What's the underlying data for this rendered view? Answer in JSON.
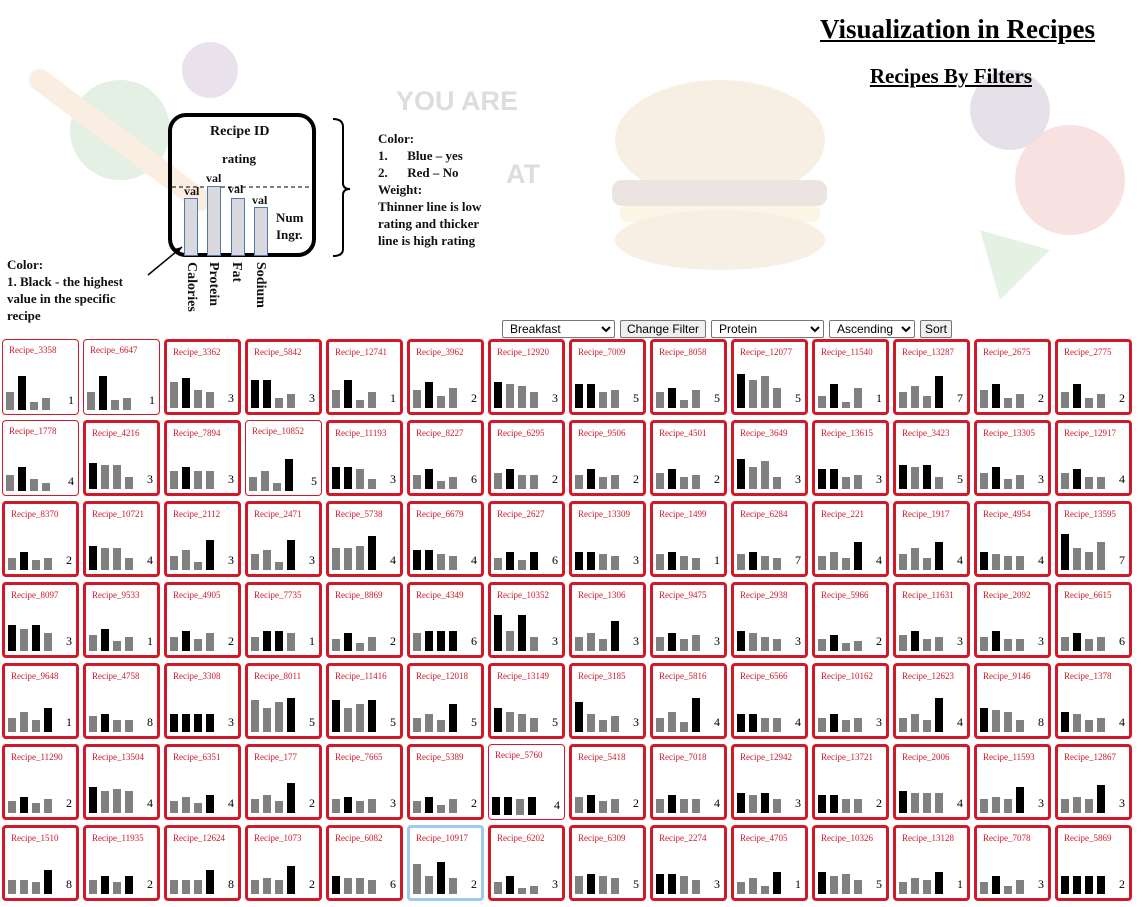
{
  "header": {
    "title": "Visualization in Recipes",
    "subtitle": "Recipes By Filters"
  },
  "background_text": {
    "line1": "YOU ARE",
    "line2": "AT"
  },
  "legend": {
    "card_title": "Recipe ID",
    "card_rating": "rating",
    "bar_value_label": "val",
    "num_ingr_line1": "Num",
    "num_ingr_line2": "Ingr.",
    "axis_labels": [
      "Calories",
      "Protein",
      "Fat",
      "Sodium"
    ],
    "color_title": "Color:",
    "color_items": [
      "1.      Blue – yes",
      "2.      Red – No"
    ],
    "weight_title": "Weight:",
    "weight_lines": [
      "Thinner line is low",
      "rating and thicker",
      "line is high rating"
    ],
    "black_title": "Color:",
    "black_lines": [
      "1. Black - the highest",
      "value in the specific",
      "recipe"
    ]
  },
  "controls": {
    "meal_selected": "Breakfast",
    "change_filter_label": "Change Filter",
    "sort_field_selected": "Protein",
    "sort_order_selected": "Ascending",
    "sort_label": "Sort"
  },
  "colors": {
    "red_border": "#d01a2a",
    "blue_border": "#9fc9ef",
    "bar_gray": "#808080",
    "bar_black": "#000000"
  },
  "recipes": [
    {
      "id": "Recipe_3358",
      "v": [
        0.45,
        0.85,
        0.2,
        0.3
      ],
      "n": 1,
      "b": "red",
      "w": 1
    },
    {
      "id": "Recipe_6647",
      "v": [
        0.45,
        0.85,
        0.25,
        0.3
      ],
      "n": 1,
      "b": "red",
      "w": 1
    },
    {
      "id": "Recipe_3362",
      "v": [
        0.65,
        0.75,
        0.45,
        0.4
      ],
      "n": 3,
      "b": "red",
      "w": 3
    },
    {
      "id": "Recipe_5842",
      "v": [
        0.7,
        0.7,
        0.25,
        0.35
      ],
      "n": 3,
      "b": "red",
      "w": 3
    },
    {
      "id": "Recipe_12741",
      "v": [
        0.45,
        0.7,
        0.2,
        0.4
      ],
      "n": 1,
      "b": "red",
      "w": 3
    },
    {
      "id": "Recipe_3962",
      "v": [
        0.45,
        0.65,
        0.3,
        0.5
      ],
      "n": 2,
      "b": "red",
      "w": 3
    },
    {
      "id": "Recipe_12920",
      "v": [
        0.65,
        0.6,
        0.55,
        0.4
      ],
      "n": 3,
      "b": "red",
      "w": 3
    },
    {
      "id": "Recipe_7009",
      "v": [
        0.6,
        0.6,
        0.4,
        0.45
      ],
      "n": 5,
      "b": "red",
      "w": 3
    },
    {
      "id": "Recipe_8058",
      "v": [
        0.4,
        0.5,
        0.2,
        0.45
      ],
      "n": 5,
      "b": "red",
      "w": 3
    },
    {
      "id": "Recipe_12077",
      "v": [
        0.85,
        0.7,
        0.8,
        0.5
      ],
      "n": 5,
      "b": "red",
      "w": 3
    },
    {
      "id": "Recipe_11540",
      "v": [
        0.3,
        0.6,
        0.15,
        0.5
      ],
      "n": 1,
      "b": "red",
      "w": 3
    },
    {
      "id": "Recipe_13287",
      "v": [
        0.4,
        0.55,
        0.3,
        0.8
      ],
      "n": 7,
      "b": "red",
      "w": 3
    },
    {
      "id": "Recipe_2675",
      "v": [
        0.45,
        0.6,
        0.25,
        0.35
      ],
      "n": 2,
      "b": "red",
      "w": 3
    },
    {
      "id": "Recipe_2775",
      "v": [
        0.4,
        0.6,
        0.25,
        0.35
      ],
      "n": 2,
      "b": "red",
      "w": 3
    },
    {
      "id": "Recipe_1778",
      "v": [
        0.4,
        0.6,
        0.3,
        0.2
      ],
      "n": 4,
      "b": "red",
      "w": 1
    },
    {
      "id": "Recipe_4216",
      "v": [
        0.65,
        0.6,
        0.6,
        0.3
      ],
      "n": 3,
      "b": "red",
      "w": 3
    },
    {
      "id": "Recipe_7894",
      "v": [
        0.45,
        0.55,
        0.45,
        0.45
      ],
      "n": 3,
      "b": "red",
      "w": 3
    },
    {
      "id": "Recipe_10852",
      "v": [
        0.35,
        0.5,
        0.2,
        0.8
      ],
      "n": 5,
      "b": "red",
      "w": 1
    },
    {
      "id": "Recipe_11193",
      "v": [
        0.55,
        0.55,
        0.5,
        0.25
      ],
      "n": 3,
      "b": "red",
      "w": 3
    },
    {
      "id": "Recipe_8227",
      "v": [
        0.35,
        0.5,
        0.2,
        0.3
      ],
      "n": 6,
      "b": "red",
      "w": 3
    },
    {
      "id": "Recipe_6295",
      "v": [
        0.4,
        0.5,
        0.35,
        0.35
      ],
      "n": 2,
      "b": "red",
      "w": 3
    },
    {
      "id": "Recipe_9506",
      "v": [
        0.35,
        0.5,
        0.3,
        0.35
      ],
      "n": 2,
      "b": "red",
      "w": 3
    },
    {
      "id": "Recipe_4501",
      "v": [
        0.4,
        0.5,
        0.3,
        0.35
      ],
      "n": 2,
      "b": "red",
      "w": 3
    },
    {
      "id": "Recipe_3649",
      "v": [
        0.75,
        0.55,
        0.7,
        0.3
      ],
      "n": 3,
      "b": "red",
      "w": 3
    },
    {
      "id": "Recipe_13615",
      "v": [
        0.5,
        0.5,
        0.3,
        0.35
      ],
      "n": 3,
      "b": "red",
      "w": 3
    },
    {
      "id": "Recipe_3423",
      "v": [
        0.6,
        0.55,
        0.6,
        0.3
      ],
      "n": 5,
      "b": "red",
      "w": 3
    },
    {
      "id": "Recipe_13305",
      "v": [
        0.4,
        0.55,
        0.25,
        0.35
      ],
      "n": 3,
      "b": "red",
      "w": 3
    },
    {
      "id": "Recipe_12917",
      "v": [
        0.4,
        0.5,
        0.3,
        0.3
      ],
      "n": 4,
      "b": "red",
      "w": 3
    },
    {
      "id": "Recipe_8370",
      "v": [
        0.3,
        0.45,
        0.25,
        0.3
      ],
      "n": 2,
      "b": "red",
      "w": 3
    },
    {
      "id": "Recipe_10721",
      "v": [
        0.6,
        0.55,
        0.55,
        0.3
      ],
      "n": 4,
      "b": "red",
      "w": 3
    },
    {
      "id": "Recipe_2112",
      "v": [
        0.35,
        0.5,
        0.2,
        0.75
      ],
      "n": 3,
      "b": "red",
      "w": 3
    },
    {
      "id": "Recipe_2471",
      "v": [
        0.4,
        0.5,
        0.2,
        0.75
      ],
      "n": 3,
      "b": "red",
      "w": 3
    },
    {
      "id": "Recipe_5738",
      "v": [
        0.55,
        0.55,
        0.6,
        0.85
      ],
      "n": 4,
      "b": "red",
      "w": 3
    },
    {
      "id": "Recipe_6679",
      "v": [
        0.5,
        0.5,
        0.4,
        0.35
      ],
      "n": 4,
      "b": "red",
      "w": 3
    },
    {
      "id": "Recipe_2627",
      "v": [
        0.3,
        0.45,
        0.25,
        0.45
      ],
      "n": 6,
      "b": "red",
      "w": 3
    },
    {
      "id": "Recipe_13309",
      "v": [
        0.45,
        0.45,
        0.4,
        0.35
      ],
      "n": 3,
      "b": "red",
      "w": 3
    },
    {
      "id": "Recipe_1499",
      "v": [
        0.4,
        0.45,
        0.35,
        0.3
      ],
      "n": 1,
      "b": "red",
      "w": 3
    },
    {
      "id": "Recipe_6284",
      "v": [
        0.4,
        0.45,
        0.35,
        0.3
      ],
      "n": 7,
      "b": "red",
      "w": 3
    },
    {
      "id": "Recipe_221",
      "v": [
        0.35,
        0.45,
        0.3,
        0.7
      ],
      "n": 4,
      "b": "red",
      "w": 3
    },
    {
      "id": "Recipe_1917",
      "v": [
        0.4,
        0.55,
        0.3,
        0.7
      ],
      "n": 4,
      "b": "red",
      "w": 3
    },
    {
      "id": "Recipe_4954",
      "v": [
        0.45,
        0.4,
        0.35,
        0.35
      ],
      "n": 4,
      "b": "red",
      "w": 3
    },
    {
      "id": "Recipe_13595",
      "v": [
        0.9,
        0.55,
        0.45,
        0.7
      ],
      "n": 7,
      "b": "red",
      "w": 3
    },
    {
      "id": "Recipe_8097",
      "v": [
        0.65,
        0.55,
        0.65,
        0.45
      ],
      "n": 3,
      "b": "red",
      "w": 3
    },
    {
      "id": "Recipe_9533",
      "v": [
        0.4,
        0.55,
        0.25,
        0.35
      ],
      "n": 1,
      "b": "red",
      "w": 3
    },
    {
      "id": "Recipe_4905",
      "v": [
        0.35,
        0.5,
        0.3,
        0.45
      ],
      "n": 2,
      "b": "red",
      "w": 3
    },
    {
      "id": "Recipe_7735",
      "v": [
        0.35,
        0.5,
        0.5,
        0.45
      ],
      "n": 1,
      "b": "red",
      "w": 3
    },
    {
      "id": "Recipe_8869",
      "v": [
        0.3,
        0.45,
        0.2,
        0.35
      ],
      "n": 2,
      "b": "red",
      "w": 3
    },
    {
      "id": "Recipe_4349",
      "v": [
        0.45,
        0.5,
        0.5,
        0.5
      ],
      "n": 6,
      "b": "red",
      "w": 3
    },
    {
      "id": "Recipe_10352",
      "v": [
        0.9,
        0.5,
        0.9,
        0.35
      ],
      "n": 3,
      "b": "red",
      "w": 3
    },
    {
      "id": "Recipe_1306",
      "v": [
        0.35,
        0.45,
        0.3,
        0.75
      ],
      "n": 3,
      "b": "red",
      "w": 3
    },
    {
      "id": "Recipe_9475",
      "v": [
        0.35,
        0.45,
        0.3,
        0.4
      ],
      "n": 3,
      "b": "red",
      "w": 3
    },
    {
      "id": "Recipe_2938",
      "v": [
        0.5,
        0.45,
        0.35,
        0.3
      ],
      "n": 3,
      "b": "red",
      "w": 3
    },
    {
      "id": "Recipe_5966",
      "v": [
        0.3,
        0.4,
        0.2,
        0.25
      ],
      "n": 2,
      "b": "red",
      "w": 3
    },
    {
      "id": "Recipe_11631",
      "v": [
        0.4,
        0.5,
        0.3,
        0.35
      ],
      "n": 3,
      "b": "red",
      "w": 3
    },
    {
      "id": "Recipe_2092",
      "v": [
        0.35,
        0.5,
        0.3,
        0.3
      ],
      "n": 3,
      "b": "red",
      "w": 3
    },
    {
      "id": "Recipe_6615",
      "v": [
        0.35,
        0.45,
        0.3,
        0.35
      ],
      "n": 6,
      "b": "red",
      "w": 3
    },
    {
      "id": "Recipe_9648",
      "v": [
        0.35,
        0.5,
        0.3,
        0.6
      ],
      "n": 1,
      "b": "red",
      "w": 3
    },
    {
      "id": "Recipe_4758",
      "v": [
        0.4,
        0.45,
        0.3,
        0.3
      ],
      "n": 8,
      "b": "red",
      "w": 3
    },
    {
      "id": "Recipe_3308",
      "v": [
        0.45,
        0.45,
        0.45,
        0.45
      ],
      "n": 3,
      "b": "red",
      "w": 3
    },
    {
      "id": "Recipe_8011",
      "v": [
        0.8,
        0.6,
        0.75,
        0.85
      ],
      "n": 5,
      "b": "red",
      "w": 3
    },
    {
      "id": "Recipe_11416",
      "v": [
        0.8,
        0.6,
        0.7,
        0.8
      ],
      "n": 5,
      "b": "red",
      "w": 3
    },
    {
      "id": "Recipe_12018",
      "v": [
        0.35,
        0.45,
        0.3,
        0.7
      ],
      "n": 5,
      "b": "red",
      "w": 3
    },
    {
      "id": "Recipe_13149",
      "v": [
        0.6,
        0.5,
        0.45,
        0.35
      ],
      "n": 5,
      "b": "red",
      "w": 3
    },
    {
      "id": "Recipe_3185",
      "v": [
        0.75,
        0.45,
        0.3,
        0.4
      ],
      "n": 3,
      "b": "red",
      "w": 3
    },
    {
      "id": "Recipe_5816",
      "v": [
        0.35,
        0.5,
        0.25,
        0.85
      ],
      "n": 4,
      "b": "red",
      "w": 3
    },
    {
      "id": "Recipe_6566",
      "v": [
        0.45,
        0.45,
        0.35,
        0.35
      ],
      "n": 4,
      "b": "red",
      "w": 3
    },
    {
      "id": "Recipe_10162",
      "v": [
        0.35,
        0.45,
        0.3,
        0.35
      ],
      "n": 3,
      "b": "red",
      "w": 3
    },
    {
      "id": "Recipe_12623",
      "v": [
        0.35,
        0.45,
        0.3,
        0.85
      ],
      "n": 4,
      "b": "red",
      "w": 3
    },
    {
      "id": "Recipe_9146",
      "v": [
        0.6,
        0.55,
        0.5,
        0.3
      ],
      "n": 8,
      "b": "red",
      "w": 3
    },
    {
      "id": "Recipe_1378",
      "v": [
        0.5,
        0.45,
        0.3,
        0.35
      ],
      "n": 4,
      "b": "red",
      "w": 3
    },
    {
      "id": "Recipe_11290",
      "v": [
        0.3,
        0.4,
        0.25,
        0.35
      ],
      "n": 2,
      "b": "red",
      "w": 3
    },
    {
      "id": "Recipe_13504",
      "v": [
        0.65,
        0.55,
        0.6,
        0.55
      ],
      "n": 4,
      "b": "red",
      "w": 3
    },
    {
      "id": "Recipe_6351",
      "v": [
        0.3,
        0.4,
        0.25,
        0.45
      ],
      "n": 4,
      "b": "red",
      "w": 3
    },
    {
      "id": "Recipe_177",
      "v": [
        0.35,
        0.45,
        0.3,
        0.75
      ],
      "n": 2,
      "b": "red",
      "w": 3
    },
    {
      "id": "Recipe_7665",
      "v": [
        0.35,
        0.4,
        0.3,
        0.35
      ],
      "n": 3,
      "b": "red",
      "w": 3
    },
    {
      "id": "Recipe_5389",
      "v": [
        0.3,
        0.4,
        0.2,
        0.35
      ],
      "n": 2,
      "b": "red",
      "w": 3
    },
    {
      "id": "Recipe_5760",
      "v": [
        0.45,
        0.45,
        0.4,
        0.45
      ],
      "n": 4,
      "b": "red",
      "w": 1
    },
    {
      "id": "Recipe_5418",
      "v": [
        0.4,
        0.45,
        0.3,
        0.35
      ],
      "n": 2,
      "b": "red",
      "w": 3
    },
    {
      "id": "Recipe_7018",
      "v": [
        0.35,
        0.45,
        0.35,
        0.35
      ],
      "n": 4,
      "b": "red",
      "w": 3
    },
    {
      "id": "Recipe_12942",
      "v": [
        0.5,
        0.45,
        0.5,
        0.35
      ],
      "n": 3,
      "b": "red",
      "w": 3
    },
    {
      "id": "Recipe_13721",
      "v": [
        0.45,
        0.45,
        0.35,
        0.35
      ],
      "n": 2,
      "b": "red",
      "w": 3
    },
    {
      "id": "Recipe_2006",
      "v": [
        0.55,
        0.5,
        0.5,
        0.5
      ],
      "n": 4,
      "b": "red",
      "w": 3
    },
    {
      "id": "Recipe_11593",
      "v": [
        0.35,
        0.4,
        0.35,
        0.65
      ],
      "n": 3,
      "b": "red",
      "w": 3
    },
    {
      "id": "Recipe_12867",
      "v": [
        0.35,
        0.4,
        0.35,
        0.7
      ],
      "n": 3,
      "b": "red",
      "w": 3
    },
    {
      "id": "Recipe_1510",
      "v": [
        0.35,
        0.35,
        0.3,
        0.6
      ],
      "n": 8,
      "b": "red",
      "w": 3
    },
    {
      "id": "Recipe_11935",
      "v": [
        0.35,
        0.45,
        0.3,
        0.45
      ],
      "n": 2,
      "b": "red",
      "w": 3
    },
    {
      "id": "Recipe_12624",
      "v": [
        0.35,
        0.35,
        0.35,
        0.6
      ],
      "n": 8,
      "b": "red",
      "w": 3
    },
    {
      "id": "Recipe_1073",
      "v": [
        0.35,
        0.4,
        0.35,
        0.7
      ],
      "n": 2,
      "b": "red",
      "w": 3
    },
    {
      "id": "Recipe_6082",
      "v": [
        0.45,
        0.4,
        0.4,
        0.35
      ],
      "n": 6,
      "b": "red",
      "w": 3
    },
    {
      "id": "Recipe_10917",
      "v": [
        0.75,
        0.45,
        0.8,
        0.4
      ],
      "n": 2,
      "b": "blue",
      "w": 3
    },
    {
      "id": "Recipe_6202",
      "v": [
        0.3,
        0.45,
        0.15,
        0.2
      ],
      "n": 3,
      "b": "red",
      "w": 3
    },
    {
      "id": "Recipe_6309",
      "v": [
        0.45,
        0.5,
        0.45,
        0.4
      ],
      "n": 5,
      "b": "red",
      "w": 3
    },
    {
      "id": "Recipe_2274",
      "v": [
        0.5,
        0.5,
        0.45,
        0.35
      ],
      "n": 3,
      "b": "red",
      "w": 3
    },
    {
      "id": "Recipe_4705",
      "v": [
        0.3,
        0.4,
        0.2,
        0.55
      ],
      "n": 1,
      "b": "red",
      "w": 3
    },
    {
      "id": "Recipe_10326",
      "v": [
        0.55,
        0.45,
        0.5,
        0.35
      ],
      "n": 5,
      "b": "red",
      "w": 3
    },
    {
      "id": "Recipe_13128",
      "v": [
        0.3,
        0.4,
        0.35,
        0.55
      ],
      "n": 1,
      "b": "red",
      "w": 3
    },
    {
      "id": "Recipe_7078",
      "v": [
        0.3,
        0.45,
        0.2,
        0.35
      ],
      "n": 3,
      "b": "red",
      "w": 3
    },
    {
      "id": "Recipe_5869",
      "v": [
        0.45,
        0.45,
        0.45,
        0.45
      ],
      "n": 2,
      "b": "red",
      "w": 3
    }
  ]
}
